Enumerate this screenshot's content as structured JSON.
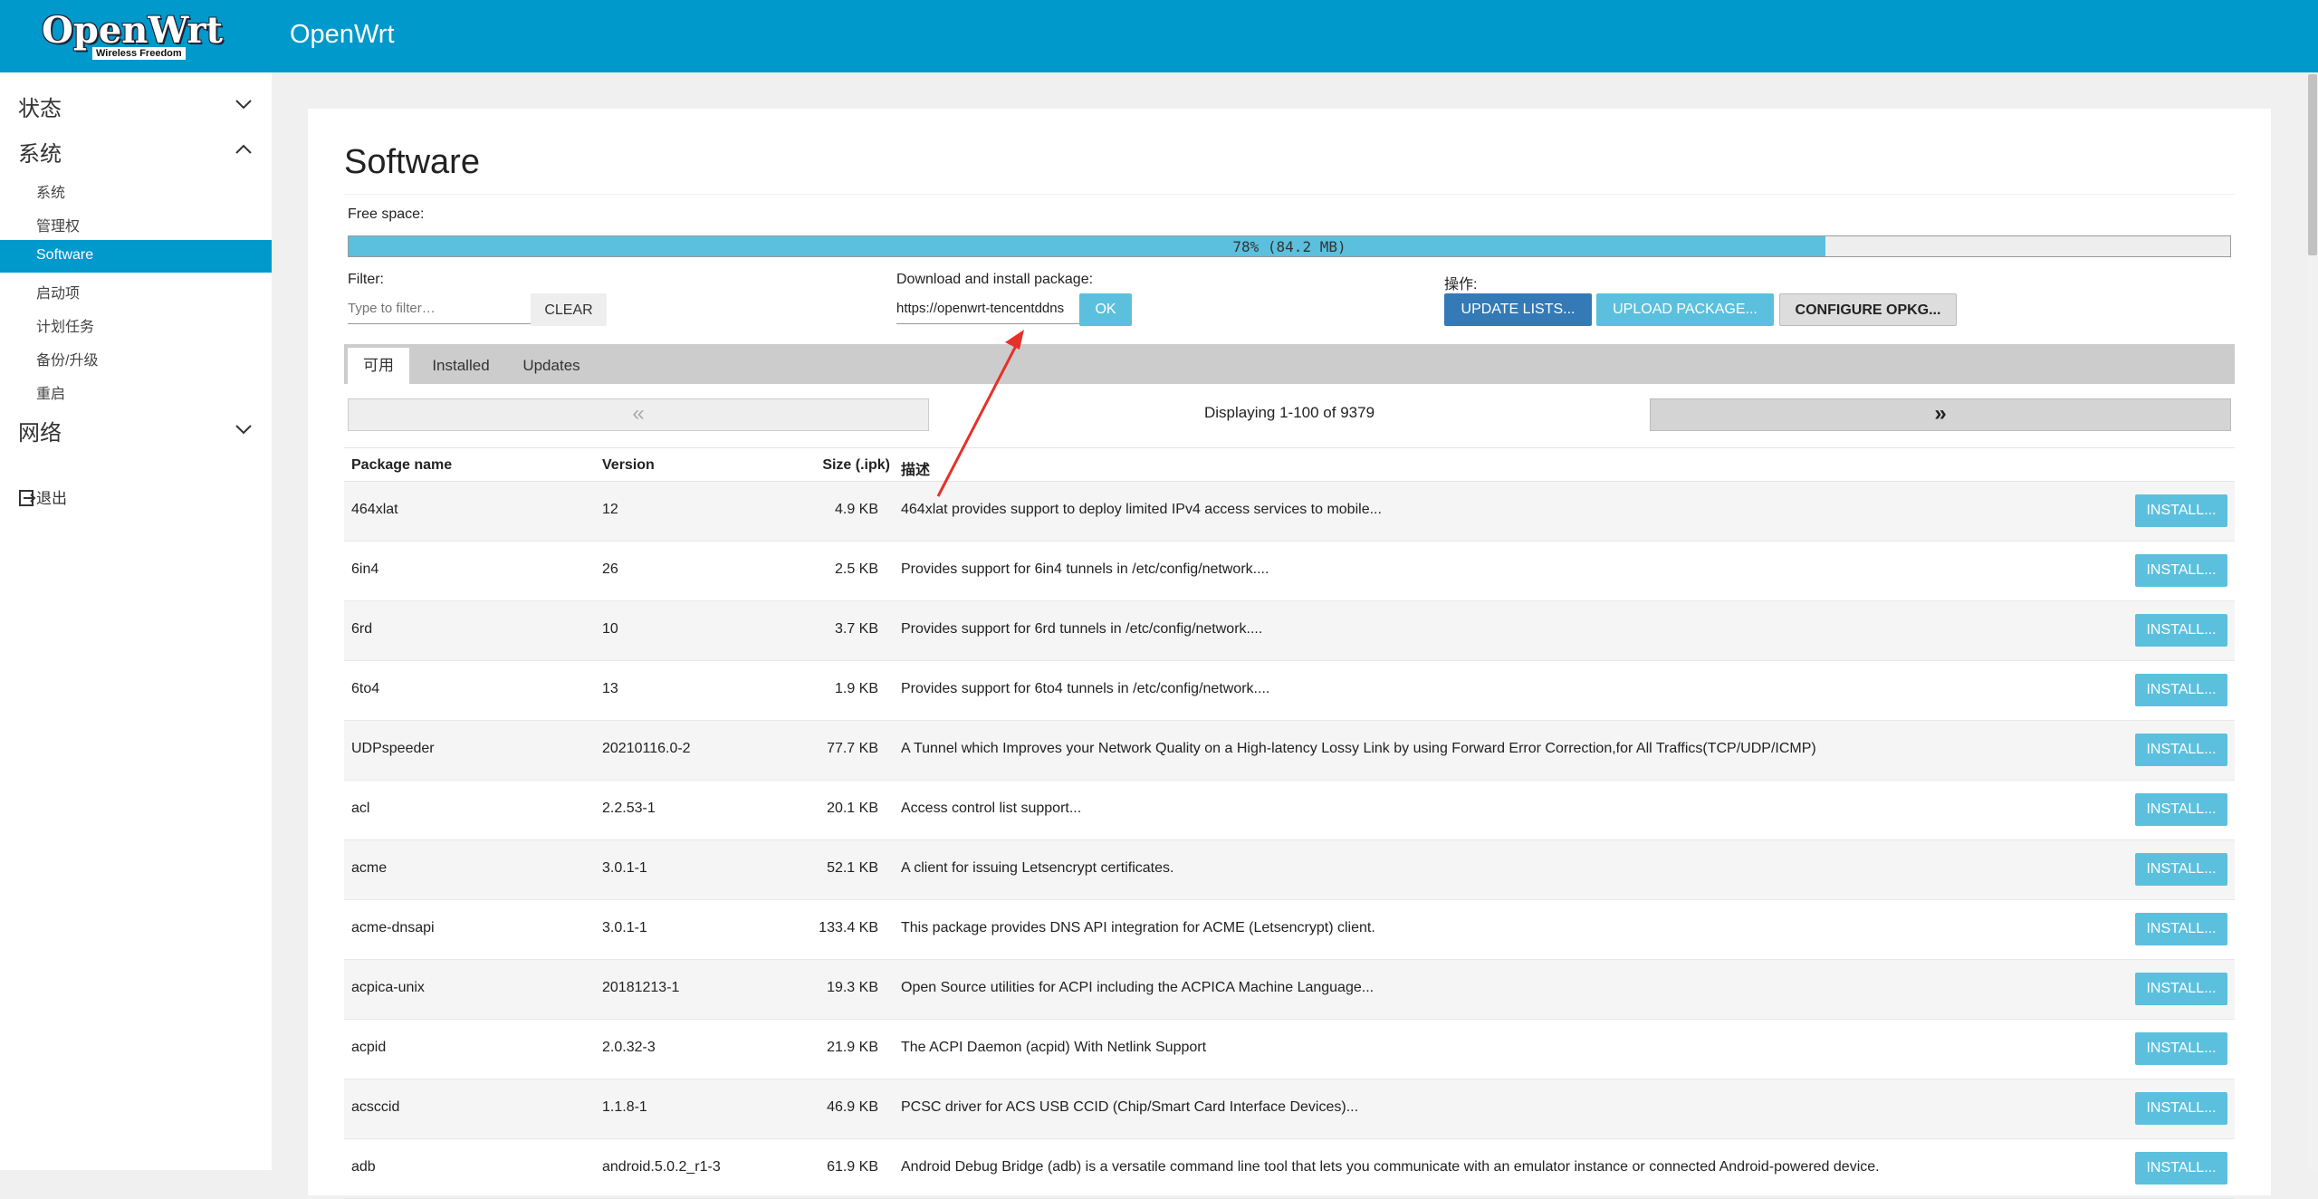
{
  "header": {
    "logo_text": "OpenWrt",
    "logo_sub": "Wireless Freedom",
    "title": "OpenWrt"
  },
  "sidebar": {
    "groups": [
      {
        "label": "状态",
        "expanded": false
      },
      {
        "label": "系统",
        "expanded": true
      },
      {
        "label": "网络",
        "expanded": false
      }
    ],
    "items": [
      {
        "label": "系统",
        "active": false
      },
      {
        "label": "管理权",
        "active": false
      },
      {
        "label": "Software",
        "active": true
      },
      {
        "label": "启动项",
        "active": false
      },
      {
        "label": "计划任务",
        "active": false
      },
      {
        "label": "备份/升级",
        "active": false
      },
      {
        "label": "重启",
        "active": false
      }
    ],
    "logout_label": "退出"
  },
  "page": {
    "title": "Software",
    "free_space_label": "Free space:",
    "progress_text": "78% (84.2 MB)",
    "progress_fraction": 0.78,
    "filter_label": "Filter:",
    "filter_placeholder": "Type to filter…",
    "clear_label": "CLEAR",
    "download_label": "Download and install package:",
    "download_value": "https://openwrt-tencentddns",
    "ok_label": "OK",
    "actions_label": "操作:",
    "update_lists_label": "UPDATE LISTS...",
    "upload_package_label": "UPLOAD PACKAGE...",
    "configure_opkg_label": "CONFIGURE OPKG...",
    "tabs": [
      "可用",
      "Installed",
      "Updates"
    ],
    "pager_prev": "«",
    "pager_next": "»",
    "pager_info": "Displaying 1-100 of 9379"
  },
  "table": {
    "headers": {
      "name": "Package name",
      "version": "Version",
      "size": "Size (.ipk)",
      "desc": "描述"
    },
    "install_label": "INSTALL...",
    "rows": [
      {
        "name": "464xlat",
        "version": "12",
        "size": "4.9 KB",
        "desc": "464xlat provides support to deploy limited IPv4 access services to mobile..."
      },
      {
        "name": "6in4",
        "version": "26",
        "size": "2.5 KB",
        "desc": "Provides support for 6in4 tunnels in /etc/config/network...."
      },
      {
        "name": "6rd",
        "version": "10",
        "size": "3.7 KB",
        "desc": "Provides support for 6rd tunnels in /etc/config/network...."
      },
      {
        "name": "6to4",
        "version": "13",
        "size": "1.9 KB",
        "desc": "Provides support for 6to4 tunnels in /etc/config/network...."
      },
      {
        "name": "UDPspeeder",
        "version": "20210116.0-2",
        "size": "77.7 KB",
        "desc": "A Tunnel which Improves your Network Quality on a High-latency Lossy Link by using Forward Error Correction,for All Traffics(TCP/UDP/ICMP)"
      },
      {
        "name": "acl",
        "version": "2.2.53-1",
        "size": "20.1 KB",
        "desc": "Access control list support..."
      },
      {
        "name": "acme",
        "version": "3.0.1-1",
        "size": "52.1 KB",
        "desc": "A client for issuing Letsencrypt certificates."
      },
      {
        "name": "acme-dnsapi",
        "version": "3.0.1-1",
        "size": "133.4 KB",
        "desc": "This package provides DNS API integration for ACME (Letsencrypt) client."
      },
      {
        "name": "acpica-unix",
        "version": "20181213-1",
        "size": "19.3 KB",
        "desc": "Open Source utilities for ACPI including the ACPICA Machine Language..."
      },
      {
        "name": "acpid",
        "version": "2.0.32-3",
        "size": "21.9 KB",
        "desc": "The ACPI Daemon (acpid) With Netlink Support"
      },
      {
        "name": "acsccid",
        "version": "1.1.8-1",
        "size": "46.9 KB",
        "desc": "PCSC driver for ACS USB CCID (Chip/Smart Card Interface Devices)..."
      },
      {
        "name": "adb",
        "version": "android.5.0.2_r1-3",
        "size": "61.9 KB",
        "desc": "Android Debug Bridge (adb) is a versatile command line tool that lets you communicate with an emulator instance or connected Android-powered device."
      }
    ]
  },
  "colors": {
    "brand": "#0099cc",
    "info": "#5bc0de",
    "primary": "#337ab7",
    "annotation": "#e8302a"
  }
}
